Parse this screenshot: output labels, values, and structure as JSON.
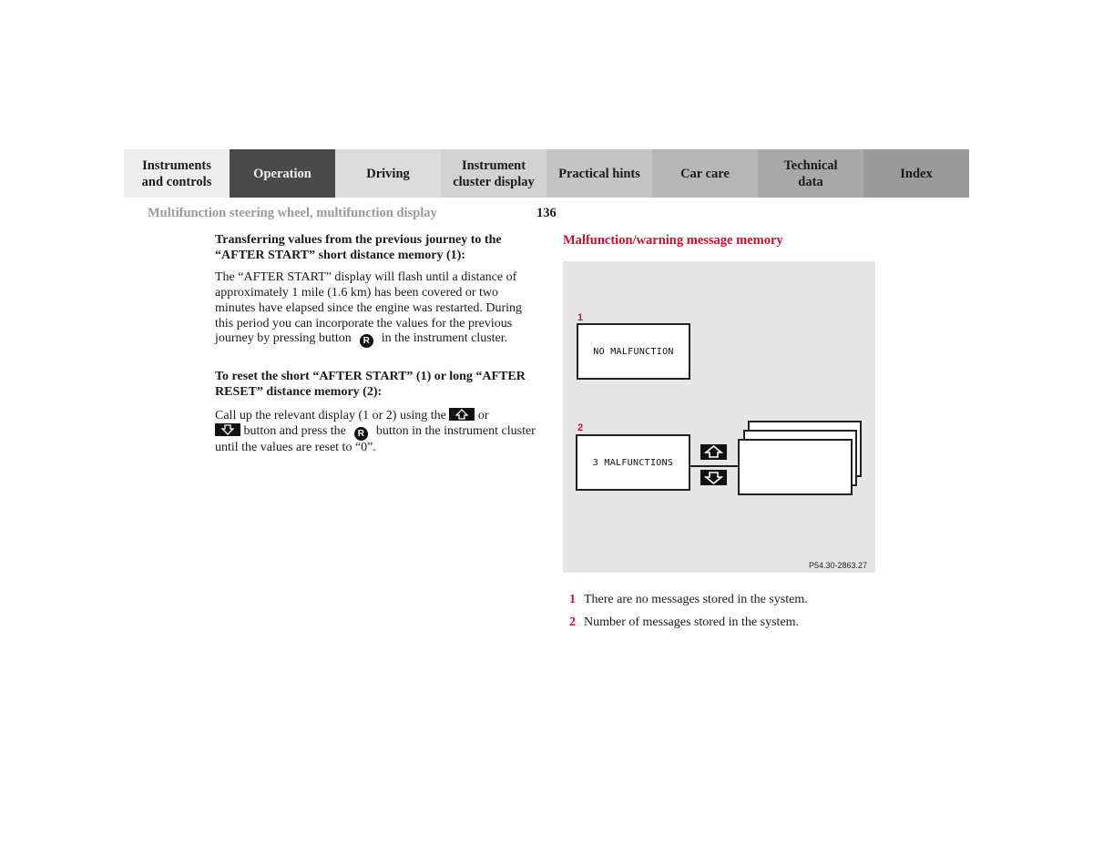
{
  "nav": {
    "tabs": [
      {
        "label_line1": "Instruments",
        "label_line2": "and controls",
        "bg": "#efefef",
        "active": false
      },
      {
        "label_line1": "Operation",
        "label_line2": "",
        "bg": "#4a4a4a",
        "active": true
      },
      {
        "label_line1": "Driving",
        "label_line2": "",
        "bg": "#dcdcdc",
        "active": false
      },
      {
        "label_line1": "Instrument",
        "label_line2": "cluster display",
        "bg": "#d2d2d2",
        "active": false
      },
      {
        "label_line1": "Practical hints",
        "label_line2": "",
        "bg": "#c4c4c4",
        "active": false
      },
      {
        "label_line1": "Car care",
        "label_line2": "",
        "bg": "#b6b6b6",
        "active": false
      },
      {
        "label_line1": "Technical",
        "label_line2": "data",
        "bg": "#a8a8a8",
        "active": false
      },
      {
        "label_line1": "Index",
        "label_line2": "",
        "bg": "#9a9a9a",
        "active": false
      }
    ]
  },
  "header": {
    "section_title": "Multifunction steering wheel, multifunction display",
    "page_number": "136"
  },
  "left_column": {
    "heading1": "Transferring values from the previous journey to the “AFTER START” short distance memory (1):",
    "para1_before": "The “AFTER START” display will flash until a distance of approximately 1 mile (1.6 km) has been covered or two minutes have elapsed since the engine was restarted. During this period you can incorporate the values for the previous journey by pressing button",
    "para1_after": "in the instrument cluster.",
    "heading2": "To reset the short “AFTER START” (1) or long “AFTER RESET” distance memory (2):",
    "para2_part1": "Call up the relevant display (1 or 2) using the",
    "para2_part2": "or",
    "para2_part3": "button and press the",
    "para2_part4": "button in the instrument cluster until the values are reset to “0”.",
    "reset_button_glyph": "R",
    "up_button_icon": "arrow-up-icon",
    "down_button_icon": "arrow-down-icon"
  },
  "right_column": {
    "title": "Malfunction/warning message memory",
    "figure": {
      "label1": "1",
      "display1_text": "NO MALFUNCTION",
      "label2": "2",
      "display2_text": "3 MALFUNCTIONS",
      "up_icon": "arrow-up-icon",
      "down_icon": "arrow-down-icon",
      "code": "P54.30-2863.27"
    },
    "legend": [
      {
        "num": "1",
        "text": "There are no messages stored in the system."
      },
      {
        "num": "2",
        "text": "Number of messages stored in the system."
      }
    ]
  },
  "colors": {
    "accent_red": "#c8102e",
    "figure_bg": "#e6e6e6",
    "header_gray": "#9a9a9a"
  }
}
